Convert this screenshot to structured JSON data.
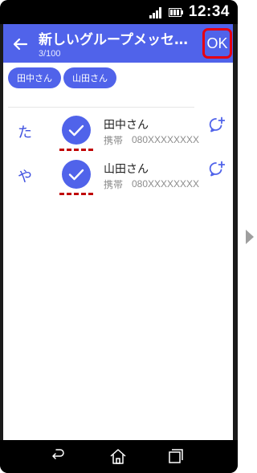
{
  "status_bar": {
    "time": "12:34"
  },
  "app_bar": {
    "title": "新しいグループメッセ…",
    "count": "3/100",
    "ok_label": "OK"
  },
  "chips": [
    {
      "label": "田中さん"
    },
    {
      "label": "山田さん"
    }
  ],
  "contacts": [
    {
      "index": "た",
      "name": "田中さん",
      "type": "携帯",
      "phone": "080XXXXXXXX",
      "selected": true
    },
    {
      "index": "や",
      "name": "山田さん",
      "type": "携帯",
      "phone": "080XXXXXXXX",
      "selected": true
    }
  ],
  "colors": {
    "accent": "#5063ea",
    "index_letter": "#3f51e0",
    "highlight": "#e60012",
    "dash": "#c00000"
  },
  "icons": {
    "back": "arrow-left-icon",
    "check": "check-circle-icon",
    "chat_add": "chat-add-icon",
    "nav_back": "nav-back-icon",
    "nav_home": "home-icon",
    "nav_recent": "recent-apps-icon",
    "next": "next-page-arrow-icon"
  }
}
